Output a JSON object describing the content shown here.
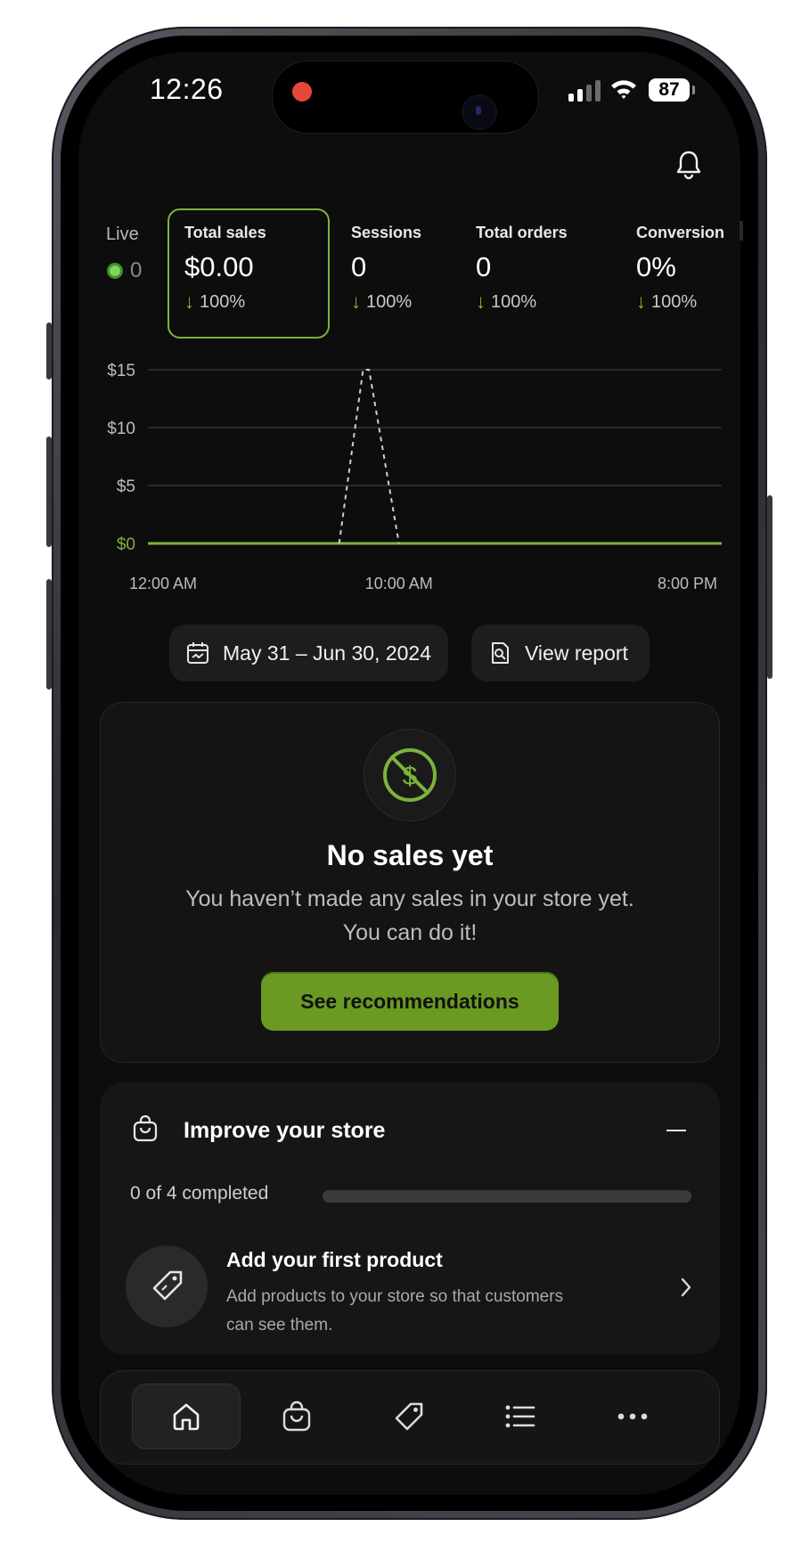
{
  "status_bar": {
    "time": "12:26",
    "battery": "87"
  },
  "live": {
    "label": "Live",
    "count": "0"
  },
  "metrics": [
    {
      "label": "Total sales",
      "value": "$0.00",
      "delta": "100%"
    },
    {
      "label": "Sessions",
      "value": "0",
      "delta": "100%"
    },
    {
      "label": "Total orders",
      "value": "0",
      "delta": "100%"
    },
    {
      "label": "Conversion",
      "value": "0%",
      "delta": "100%"
    }
  ],
  "date_range": "May 31 – Jun 30, 2024",
  "view_report": "View report",
  "no_sales": {
    "title": "No sales yet",
    "line1": "You haven’t made any sales in your store yet.",
    "line2": "You can do it!",
    "button": "See recommendations"
  },
  "improve": {
    "title": "Improve your store",
    "progress_text": "0 of 4 completed",
    "progress": 0,
    "task_title": "Add your first product",
    "task_desc": "Add products to your store so that customers can see them."
  },
  "tabs": [
    "home-icon",
    "bag-icon",
    "tag-icon",
    "list-icon",
    "more-icon"
  ],
  "colors": {
    "accent": "#7bb33b",
    "button": "#6a9a22",
    "background": "#0d0d0d"
  },
  "chart_data": {
    "type": "line",
    "x_labels": [
      "12:00 AM",
      "10:00 AM",
      "8:00 PM"
    ],
    "y_ticks": [
      "$15",
      "$10",
      "$5",
      "$0"
    ],
    "ylim": [
      0,
      15
    ],
    "grid": true,
    "series": [
      {
        "style": "solid",
        "color": "#7bb33b",
        "x": [
          0,
          24
        ],
        "y": [
          0,
          0
        ]
      },
      {
        "style": "dashed",
        "color": "#cfcfcf",
        "x": [
          8,
          9,
          9.25,
          10.5
        ],
        "y": [
          0,
          15,
          15,
          0
        ]
      }
    ]
  }
}
